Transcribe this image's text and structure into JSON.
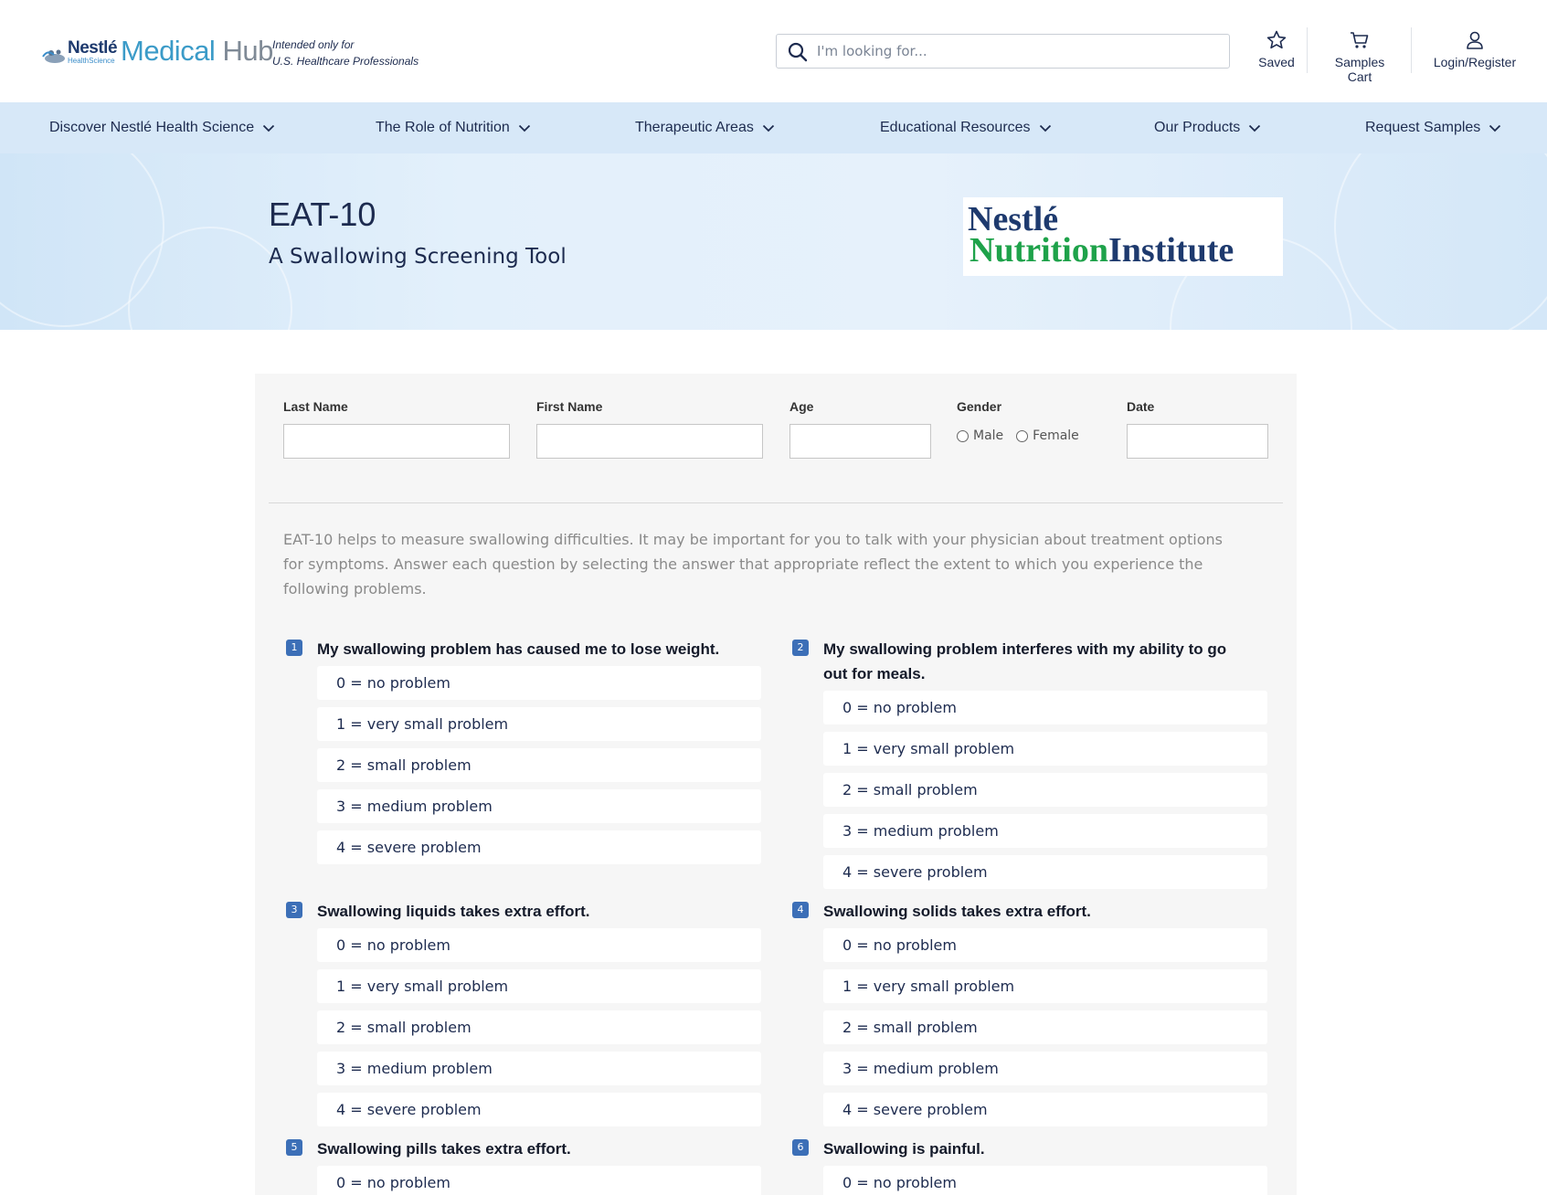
{
  "header": {
    "logo": {
      "brand": "Nestlé",
      "brand_sub": "HealthScience",
      "medical": "Medical",
      "hub": "Hub"
    },
    "intended_line1": "Intended only for",
    "intended_line2": "U.S. Healthcare Professionals",
    "search_placeholder": "I'm looking for...",
    "actions": {
      "saved": "Saved",
      "cart": "Samples Cart",
      "login": "Login/Register"
    }
  },
  "nav": {
    "items": [
      {
        "label": "Discover Nestlé Health Science"
      },
      {
        "label": "The Role of Nutrition"
      },
      {
        "label": "Therapeutic Areas"
      },
      {
        "label": "Educational Resources"
      },
      {
        "label": "Our Products"
      },
      {
        "label": "Request Samples"
      }
    ]
  },
  "hero": {
    "title": "EAT-10",
    "subtitle": "A Swallowing Screening Tool",
    "logo_line1": "Nestlé",
    "logo_nutrition": "Nutrition",
    "logo_institute": "Institute"
  },
  "form": {
    "last_name_label": "Last Name",
    "first_name_label": "First Name",
    "age_label": "Age",
    "gender_label": "Gender",
    "gender_male": "Male",
    "gender_female": "Female",
    "date_label": "Date",
    "intro": "EAT-10 helps to measure swallowing difficulties. It may be important for you to talk with your physician about treatment options for symptoms. Answer each question by selecting the answer that appropriate reflect the extent to which you experience the following problems."
  },
  "options": [
    "0 = no problem",
    "1 = very small problem",
    "2 = small problem",
    "3 = medium problem",
    "4 = severe problem"
  ],
  "questions": [
    {
      "num": "1",
      "text": "My swallowing problem has caused me to lose weight."
    },
    {
      "num": "2",
      "text": "My swallowing problem interferes with my ability to go out for meals."
    },
    {
      "num": "3",
      "text": "Swallowing liquids takes extra effort."
    },
    {
      "num": "4",
      "text": "Swallowing solids takes extra effort."
    },
    {
      "num": "5",
      "text": "Swallowing pills takes extra effort."
    },
    {
      "num": "6",
      "text": "Swallowing is painful."
    }
  ],
  "colors": {
    "nav_bg": "#d7e8f8",
    "badge": "#3c6fb7",
    "panel_bg": "#f6f6f6",
    "brand_navy": "#1e3a6e",
    "brand_green": "#1ea24a"
  }
}
